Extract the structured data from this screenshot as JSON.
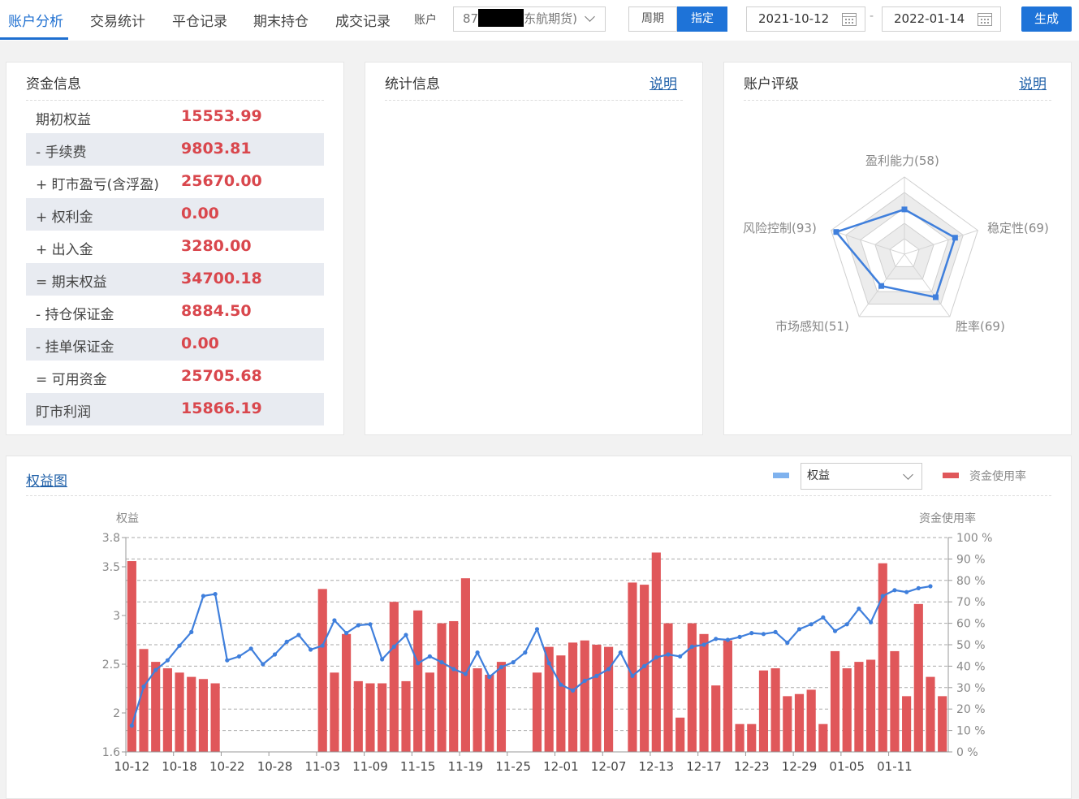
{
  "nav": {
    "tabs": [
      "账户分析",
      "交易统计",
      "平仓记录",
      "期末持仓",
      "成交记录"
    ],
    "account_label": "账户",
    "account_prefix": "87",
    "account_suffix": "东航期货)",
    "period_label": "周期",
    "specify_label": "指定",
    "start_date": "2021-10-12",
    "date_separator": "-",
    "end_date": "2022-01-14",
    "generate_label": "生成"
  },
  "funds": {
    "title": "资金信息",
    "rows": [
      {
        "label": "期初权益",
        "value": "15553.99"
      },
      {
        "label": "- 手续费",
        "value": "9803.81"
      },
      {
        "label": "+ 盯市盈亏(含浮盈)",
        "value": "25670.00"
      },
      {
        "label": "+ 权利金",
        "value": "0.00"
      },
      {
        "label": "+ 出入金",
        "value": "3280.00"
      },
      {
        "label": "= 期末权益",
        "value": "34700.18"
      },
      {
        "label": "- 持仓保证金",
        "value": "8884.50"
      },
      {
        "label": "- 挂单保证金",
        "value": "0.00"
      },
      {
        "label": "= 可用资金",
        "value": "25705.68"
      },
      {
        "label": "盯市利润",
        "value": "15866.19"
      }
    ]
  },
  "stats": {
    "title": "统计信息",
    "help_link": "说明"
  },
  "rating": {
    "title": "账户评级",
    "help_link": "说明",
    "dimensions": [
      {
        "label": "盈利能力(58)",
        "score": 58
      },
      {
        "label": "稳定性(69)",
        "score": 69
      },
      {
        "label": "胜率(69)",
        "score": 69
      },
      {
        "label": "市场感知(51)",
        "score": 51
      },
      {
        "label": "风险控制(93)",
        "score": 93
      }
    ],
    "colors": {
      "line": "#3f7fdc",
      "grid_fill": "#ececec"
    }
  },
  "equity": {
    "title": "权益图",
    "metric_select": "权益",
    "legend_usage": "资金使用率",
    "colors": {
      "line": "#3f7fdc",
      "line_legend": "#7fb2ee",
      "bar": "#e0575a"
    }
  },
  "chart_data": {
    "type": "bar+line",
    "title": "权益图",
    "ylabel": "权益",
    "y2label": "资金使用率",
    "ylim": [
      1.6,
      3.8
    ],
    "y_ticks": [
      "1.6",
      "2",
      "2.5",
      "3",
      "3.5",
      "3.8"
    ],
    "y2lim": [
      0,
      100
    ],
    "y2_ticks": [
      "0 %",
      "10 %",
      "20 %",
      "30 %",
      "40 %",
      "50 %",
      "60 %",
      "70 %",
      "80 %",
      "90 %",
      "100 %"
    ],
    "x_tick_labels": [
      "10-12",
      "10-18",
      "10-22",
      "10-28",
      "11-03",
      "11-09",
      "11-15",
      "11-19",
      "11-25",
      "12-01",
      "12-07",
      "12-13",
      "12-17",
      "12-23",
      "12-29",
      "01-05",
      "01-11"
    ],
    "x_tick_index": [
      0,
      4,
      8,
      12,
      16,
      20,
      24,
      28,
      32,
      36,
      40,
      44,
      48,
      52,
      56,
      60,
      64
    ],
    "grid": true,
    "series": [
      {
        "name": "资金使用率",
        "type": "bar",
        "axis": "right",
        "values": [
          89,
          48,
          42,
          39,
          37,
          35,
          34,
          32,
          0,
          0,
          0,
          0,
          0,
          0,
          0,
          0,
          76,
          37,
          55,
          33,
          32,
          32,
          70,
          33,
          66,
          37,
          60,
          61,
          81,
          39,
          36,
          42,
          0,
          0,
          37,
          49,
          45,
          51,
          52,
          50,
          49,
          0,
          79,
          78,
          93,
          60,
          16,
          60,
          55,
          31,
          52,
          13,
          13,
          38,
          39,
          26,
          27,
          29,
          13,
          47,
          39,
          42,
          43,
          88,
          47,
          26,
          69,
          35,
          26
        ]
      },
      {
        "name": "权益",
        "type": "line",
        "axis": "left",
        "values": [
          1.87,
          2.27,
          2.44,
          2.54,
          2.69,
          2.83,
          3.2,
          3.22,
          2.54,
          2.58,
          2.66,
          2.5,
          2.6,
          2.73,
          2.8,
          2.65,
          2.69,
          2.95,
          2.82,
          2.9,
          2.91,
          2.55,
          2.68,
          2.8,
          2.51,
          2.58,
          2.52,
          2.45,
          2.4,
          2.62,
          2.37,
          2.47,
          2.52,
          2.62,
          2.86,
          2.51,
          2.29,
          2.23,
          2.33,
          2.38,
          2.45,
          2.62,
          2.38,
          2.48,
          2.57,
          2.6,
          2.58,
          2.68,
          2.7,
          2.76,
          2.75,
          2.78,
          2.82,
          2.81,
          2.83,
          2.72,
          2.86,
          2.91,
          2.98,
          2.84,
          2.91,
          3.07,
          2.93,
          3.2,
          3.26,
          3.24,
          3.28,
          3.3
        ]
      }
    ]
  }
}
